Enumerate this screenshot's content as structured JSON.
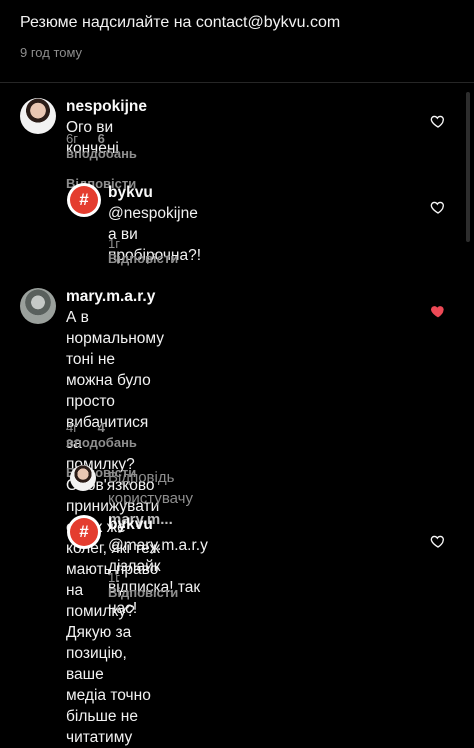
{
  "header": {
    "text": "Резюме надсилайте на contact@bykvu.com",
    "time": "9 год тому"
  },
  "comments": [
    {
      "username": "nespokijne",
      "text": "Ого ви кончені",
      "time": "6г",
      "likes": "6 вподобань",
      "reply": "Відповісти",
      "liked": false
    },
    {
      "username": "bykvu",
      "mention": "@nespokijne",
      "text_line1": "а ви",
      "text_line2": "пробірочна?!",
      "time": "1г",
      "reply": "Відповісти",
      "liked": false
    },
    {
      "username": "mary.m.a.r.y",
      "text_line1": "А в нормальному тоні не",
      "text_line2": "можна було просто вибачитися за",
      "text_line3": "помилку? Обов'язково принижувати",
      "text_line4": "своїх же колег, які теж мають право на",
      "text_line5": "помилку? Дякую за позицію, ваше",
      "text_line6": "медіа точно більше не читатиму",
      "time": "4г",
      "likes": "4 вподобань",
      "reply": "Відповісти",
      "liked": true
    },
    {
      "reply_prefix": "Відповідь користувачу",
      "reply_user": "mary.m..."
    },
    {
      "username": "bykvu",
      "mention": "@mary.m.a.r.y",
      "text_line1": "дізлайк",
      "text_line2": "відписка! так нас!",
      "time": "1г",
      "reply": "Відповісти",
      "liked": false
    }
  ],
  "icons": {
    "heart_outline": "heart-outline-icon",
    "heart_filled": "heart-filled-icon",
    "hash_logo": "hash-logo-icon"
  },
  "colors": {
    "background": "#000000",
    "muted": "#8e8e8e",
    "like_red": "#ed4956",
    "brand_red": "#e43d2f"
  }
}
